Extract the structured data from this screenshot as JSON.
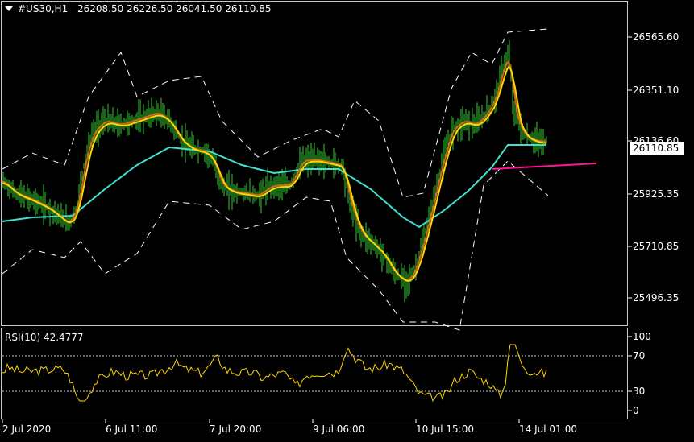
{
  "header": {
    "symbol": "#US30,H1",
    "ohlc": "26208.50 26226.50 26041.50 26110.85"
  },
  "indicator": {
    "label": "RSI(10) 42.4777"
  },
  "price_axis": {
    "labels": [
      "26565.60",
      "26351.10",
      "26136.60",
      "25925.35",
      "25710.85",
      "25496.35"
    ],
    "current_price": "26110.85"
  },
  "rsi_axis": {
    "labels": [
      "100",
      "70",
      "30",
      "0"
    ]
  },
  "time_axis": {
    "labels": [
      "2 Jul 2020",
      "6 Jul 11:00",
      "7 Jul 20:00",
      "9 Jul 06:00",
      "10 Jul 15:00",
      "14 Jul 01:00"
    ]
  },
  "colors": {
    "background": "#000000",
    "candles": "#32cd32",
    "ma_fast": "#ffd700",
    "ma_mid": "#d2691e",
    "ma_slow": "#40e0d0",
    "bands": "#ffffff",
    "trend": "#ff1493",
    "rsi": "#ffd700"
  }
}
